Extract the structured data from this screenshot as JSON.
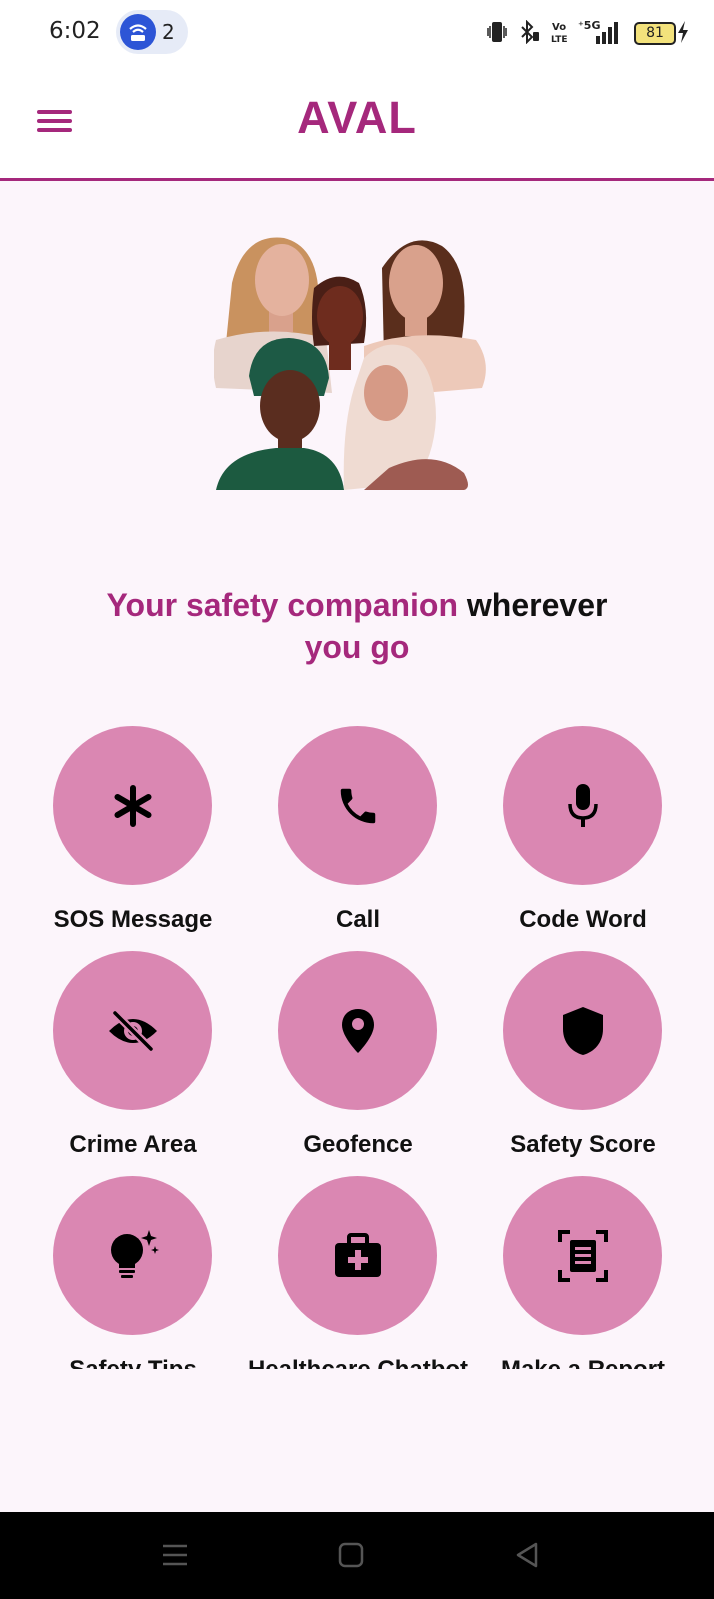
{
  "status_bar": {
    "time": "6:02",
    "hotspot_count": "2",
    "battery_level": "81"
  },
  "app": {
    "title": "AVAL",
    "brand_color": "#a5287c",
    "tile_color": "#da87b2"
  },
  "hero": {
    "tagline_accent": "Your safety companion",
    "tagline_plain": "wherever",
    "tagline_end": "you go"
  },
  "tiles": [
    {
      "label": "SOS Message",
      "icon": "asterisk-icon"
    },
    {
      "label": "Call",
      "icon": "phone-icon"
    },
    {
      "label": "Code Word",
      "icon": "microphone-icon"
    },
    {
      "label": "Crime Area",
      "icon": "eye-off-icon"
    },
    {
      "label": "Geofence",
      "icon": "location-pin-icon"
    },
    {
      "label": "Safety Score",
      "icon": "shield-icon"
    },
    {
      "label": "Safety Tips",
      "icon": "lightbulb-icon"
    },
    {
      "label": "Healthcare Chatbot",
      "icon": "medical-kit-icon"
    },
    {
      "label": "Make a Report",
      "icon": "document-scan-icon"
    }
  ]
}
